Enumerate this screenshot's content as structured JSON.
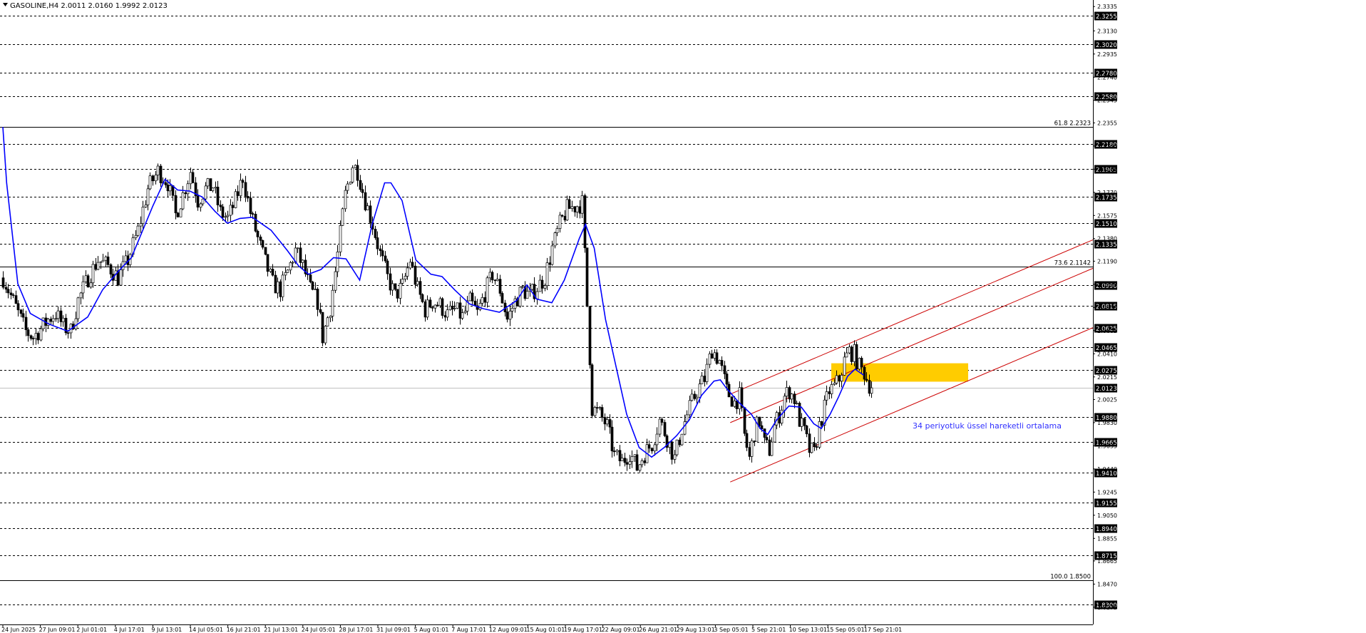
{
  "chart_data": {
    "type": "candlestick",
    "symbol_header": "GASOLINE,H4  2.0011 2.0160 1.9992 2.0123",
    "timeframe": "H4",
    "last_ohlc": {
      "open": 2.0011,
      "high": 2.016,
      "low": 1.9992,
      "close": 2.0123
    },
    "y_range": [
      1.813,
      2.339
    ],
    "y_axis_ticks": [
      "2.3335",
      "2.3130",
      "2.2935",
      "2.2740",
      "2.2545",
      "2.2355",
      "2.2160",
      "2.1965",
      "2.1770",
      "2.1575",
      "2.1380",
      "2.1190",
      "2.0995",
      "2.0800",
      "2.0605",
      "2.0410",
      "2.0215",
      "2.0025",
      "1.9830",
      "1.9635",
      "1.9440",
      "1.9245",
      "1.9050",
      "1.8855",
      "1.8665",
      "1.8470",
      "1.8275"
    ],
    "x_axis_labels": [
      "24 Jun 2025",
      "27 Jun 09:01",
      "2 Jul 01:01",
      "4 Jul 17:01",
      "9 Jul 13:01",
      "14 Jul 05:01",
      "16 Jul 21:01",
      "21 Jul 13:01",
      "24 Jul 05:01",
      "28 Jul 17:01",
      "31 Jul 09:01",
      "5 Aug 01:01",
      "7 Aug 17:01",
      "12 Aug 09:01",
      "15 Aug 01:01",
      "19 Aug 17:01",
      "22 Aug 09:01",
      "26 Aug 21:01",
      "29 Aug 13:01",
      "3 Sep 05:01",
      "5 Sep 21:01",
      "10 Sep 13:01",
      "15 Sep 05:01",
      "17 Sep 21:01"
    ],
    "horizontal_levels": [
      "2.3255",
      "2.3020",
      "2.2780",
      "2.2580",
      "2.2180",
      "2.1965",
      "2.1735",
      "2.1510",
      "2.1335",
      "2.0990",
      "2.0815",
      "2.0625",
      "2.0465",
      "2.0275",
      "1.9880",
      "1.9665",
      "1.9410",
      "1.9155",
      "1.8940",
      "1.8715",
      "1.8300"
    ],
    "fibonacci_levels": [
      {
        "label": "61.8 2.2323",
        "value": 2.2323
      },
      {
        "label": "73.6 2.1142",
        "value": 2.1142
      },
      {
        "label": "100.0 1.8500",
        "value": 1.85
      }
    ],
    "current_price_label": "2.0123",
    "current_price": 2.0123,
    "zone": {
      "top": 2.033,
      "bottom": 2.0175
    },
    "annotation": "34 periyotluk üssel hareketli ortalama",
    "ema_period": 34,
    "ema_path": [
      [
        2.232,
        0
      ],
      [
        2.185,
        3
      ],
      [
        2.1,
        12
      ],
      [
        2.075,
        22
      ],
      [
        2.066,
        37
      ],
      [
        2.06,
        52
      ],
      [
        2.072,
        68
      ],
      [
        2.095,
        80
      ],
      [
        2.111,
        93
      ],
      [
        2.122,
        103
      ],
      [
        2.165,
        120
      ],
      [
        2.188,
        130
      ],
      [
        2.179,
        140
      ],
      [
        2.178,
        150
      ],
      [
        2.173,
        160
      ],
      [
        2.161,
        170
      ],
      [
        2.151,
        180
      ],
      [
        2.155,
        190
      ],
      [
        2.156,
        200
      ],
      [
        2.145,
        215
      ],
      [
        2.128,
        228
      ],
      [
        2.115,
        237
      ],
      [
        2.108,
        245
      ],
      [
        2.112,
        255
      ],
      [
        2.122,
        265
      ],
      [
        2.121,
        275
      ],
      [
        2.103,
        286
      ],
      [
        2.15,
        296
      ],
      [
        2.185,
        306
      ],
      [
        2.185,
        311
      ],
      [
        2.17,
        320
      ],
      [
        2.12,
        331
      ],
      [
        2.108,
        343
      ],
      [
        2.106,
        352
      ],
      [
        2.095,
        362
      ],
      [
        2.083,
        374
      ],
      [
        2.079,
        385
      ],
      [
        2.076,
        398
      ],
      [
        2.086,
        412
      ],
      [
        2.099,
        420
      ],
      [
        2.087,
        428
      ],
      [
        2.084,
        440
      ],
      [
        2.103,
        450
      ],
      [
        2.138,
        462
      ],
      [
        2.15,
        467
      ],
      [
        2.13,
        474
      ],
      [
        2.07,
        483
      ],
      [
        1.99,
        500
      ],
      [
        1.962,
        510
      ],
      [
        1.954,
        520
      ],
      [
        1.962,
        530
      ],
      [
        1.972,
        540
      ],
      [
        1.985,
        550
      ],
      [
        2.006,
        560
      ],
      [
        2.018,
        570
      ],
      [
        2.019,
        575
      ],
      [
        2.012,
        580
      ],
      [
        2.0,
        590
      ],
      [
        1.99,
        600
      ],
      [
        1.978,
        607
      ],
      [
        1.973,
        613
      ],
      [
        1.985,
        620
      ],
      [
        1.997,
        630
      ],
      [
        1.996,
        640
      ],
      [
        1.982,
        650
      ],
      [
        1.978,
        656
      ],
      [
        1.99,
        663
      ],
      [
        2.005,
        670
      ],
      [
        2.022,
        677
      ],
      [
        2.028,
        683
      ],
      [
        2.023,
        690
      ]
    ],
    "channel_lines": [
      {
        "start": [
          1.933,
          583
        ],
        "end": [
          2.063,
          861
        ]
      },
      {
        "start": [
          1.983,
          583
        ],
        "end": [
          2.113,
          861
        ]
      },
      {
        "start": [
          2.007,
          583
        ],
        "end": [
          2.137,
          861
        ]
      }
    ],
    "price_path": [
      [
        2.105,
        0
      ],
      [
        2.09,
        6
      ],
      [
        2.075,
        12
      ],
      [
        2.06,
        18
      ],
      [
        2.055,
        24
      ],
      [
        2.062,
        30
      ],
      [
        2.07,
        36
      ],
      [
        2.075,
        42
      ],
      [
        2.064,
        48
      ],
      [
        2.06,
        54
      ],
      [
        2.086,
        60
      ],
      [
        2.105,
        68
      ],
      [
        2.12,
        76
      ],
      [
        2.115,
        84
      ],
      [
        2.105,
        92
      ],
      [
        2.12,
        100
      ],
      [
        2.145,
        108
      ],
      [
        2.18,
        116
      ],
      [
        2.195,
        124
      ],
      [
        2.185,
        132
      ],
      [
        2.158,
        138
      ],
      [
        2.175,
        144
      ],
      [
        2.195,
        150
      ],
      [
        2.17,
        156
      ],
      [
        2.18,
        162
      ],
      [
        2.182,
        168
      ],
      [
        2.16,
        174
      ],
      [
        2.155,
        180
      ],
      [
        2.17,
        186
      ],
      [
        2.19,
        192
      ],
      [
        2.16,
        198
      ],
      [
        2.138,
        204
      ],
      [
        2.118,
        210
      ],
      [
        2.1,
        216
      ],
      [
        2.095,
        222
      ],
      [
        2.11,
        228
      ],
      [
        2.128,
        234
      ],
      [
        2.115,
        240
      ],
      [
        2.095,
        246
      ],
      [
        2.085,
        252
      ],
      [
        2.055,
        256
      ],
      [
        2.08,
        262
      ],
      [
        2.125,
        268
      ],
      [
        2.175,
        274
      ],
      [
        2.2,
        280
      ],
      [
        2.195,
        284
      ],
      [
        2.17,
        290
      ],
      [
        2.15,
        296
      ],
      [
        2.125,
        302
      ],
      [
        2.105,
        308
      ],
      [
        2.09,
        314
      ],
      [
        2.098,
        320
      ],
      [
        2.12,
        326
      ],
      [
        2.095,
        332
      ],
      [
        2.078,
        338
      ],
      [
        2.085,
        344
      ],
      [
        2.082,
        350
      ],
      [
        2.074,
        356
      ],
      [
        2.078,
        362
      ],
      [
        2.072,
        368
      ],
      [
        2.085,
        374
      ],
      [
        2.075,
        380
      ],
      [
        2.092,
        386
      ],
      [
        2.108,
        392
      ],
      [
        2.095,
        398
      ],
      [
        2.07,
        404
      ],
      [
        2.085,
        410
      ],
      [
        2.095,
        416
      ],
      [
        2.09,
        422
      ],
      [
        2.097,
        428
      ],
      [
        2.105,
        434
      ],
      [
        2.13,
        440
      ],
      [
        2.15,
        446
      ],
      [
        2.163,
        452
      ],
      [
        2.165,
        458
      ],
      [
        2.168,
        464
      ],
      [
        1.995,
        472
      ],
      [
        1.99,
        478
      ],
      [
        1.98,
        484
      ],
      [
        1.955,
        490
      ],
      [
        1.95,
        496
      ],
      [
        1.958,
        502
      ],
      [
        1.945,
        508
      ],
      [
        1.957,
        514
      ],
      [
        1.965,
        520
      ],
      [
        1.985,
        526
      ],
      [
        1.97,
        532
      ],
      [
        1.953,
        538
      ],
      [
        1.978,
        544
      ],
      [
        1.995,
        550
      ],
      [
        2.01,
        556
      ],
      [
        2.02,
        562
      ],
      [
        2.045,
        568
      ],
      [
        2.035,
        574
      ],
      [
        2.01,
        580
      ],
      [
        2.0,
        586
      ],
      [
        2.005,
        590
      ],
      [
        1.972,
        594
      ],
      [
        1.953,
        598
      ],
      [
        1.975,
        602
      ],
      [
        1.985,
        606
      ],
      [
        1.965,
        610
      ],
      [
        1.96,
        614
      ],
      [
        1.98,
        618
      ],
      [
        1.99,
        622
      ],
      [
        2.005,
        626
      ],
      [
        2.01,
        630
      ],
      [
        2.003,
        634
      ],
      [
        1.985,
        638
      ],
      [
        1.975,
        642
      ],
      [
        1.96,
        646
      ],
      [
        1.957,
        650
      ],
      [
        1.98,
        654
      ],
      [
        1.995,
        658
      ],
      [
        2.01,
        662
      ],
      [
        2.013,
        666
      ],
      [
        2.02,
        670
      ],
      [
        2.035,
        674
      ],
      [
        2.043,
        678
      ],
      [
        2.041,
        682
      ],
      [
        2.03,
        686
      ],
      [
        2.025,
        690
      ],
      [
        2.015,
        694
      ],
      [
        2.012,
        696
      ]
    ],
    "colors": {
      "background": "#ffffff",
      "candle": "#000000",
      "ema": "#0000ff",
      "channel": "#cc0000",
      "zone": "#ffcc00",
      "grid_dashed": "#000000",
      "fib_line": "#000000",
      "annotation_text": "#3030ff",
      "axis_label_bg": "#000000",
      "axis_label_text": "#ffffff"
    }
  }
}
